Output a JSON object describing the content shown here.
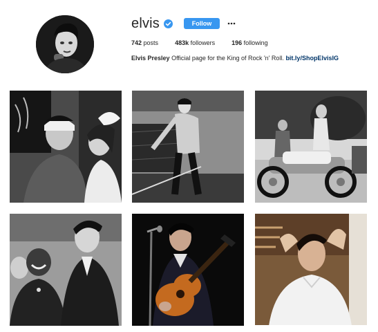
{
  "profile": {
    "username": "elvis",
    "verified": true,
    "follow_label": "Follow",
    "more_icon": "more-dots-icon",
    "posts_count": "742",
    "posts_label": "posts",
    "followers_count": "483k",
    "followers_label": "followers",
    "following_count": "196",
    "following_label": "following",
    "bio_name": "Elvis Presley",
    "bio_text": "Official page for the King of Rock 'n' Roll.",
    "bio_link": "bit.ly/ShopElvisIG"
  },
  "colors": {
    "follow_button": "#3897f0",
    "verified_badge": "#3897f0",
    "link": "#003569",
    "text": "#262626"
  },
  "posts": [
    {
      "subject": "masquerade-party-photo"
    },
    {
      "subject": "stage-performance-photo"
    },
    {
      "subject": "motorcycle-group-photo"
    },
    {
      "subject": "group-portrait-photo"
    },
    {
      "subject": "guitar-performance-photo"
    },
    {
      "subject": "hair-combing-photo"
    }
  ]
}
